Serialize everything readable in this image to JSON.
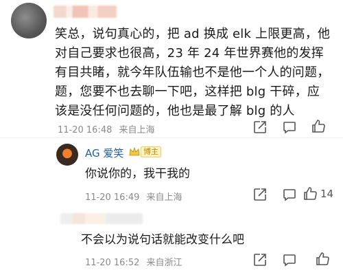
{
  "comment1": {
    "text_lines": [
      "笑总，说句真心的，把 ad 换成 elk 上限更高，他",
      "对自己要求也很高，23 年 24 年世界赛他的发挥",
      "有目共睹，就今年队伍输也不是他一个人的问题，",
      "题，您要不也去聊一下吧，这样把 blg 干碎，应",
      "该是没任何问题的，他也是最了解 blg 的人"
    ],
    "time": "11-20 16:48",
    "location": "来自上海"
  },
  "reply_ag": {
    "name": "AG 爱笑",
    "badge": "博主",
    "text": "你说你的，我干我的",
    "time": "11-20 16:49",
    "location": "来自上海",
    "like_count": "14"
  },
  "reply3": {
    "text": "不会以为说句话就能改变什么吧",
    "time": "11-20 16:52",
    "location": "来自浙江"
  },
  "icons": {
    "share": "share-icon",
    "comment": "comment-icon",
    "like": "thumbs-up-icon"
  },
  "colors": {
    "name_link": "#1f5fa8",
    "meta": "#8a8a8a",
    "badge": "#f0cf66"
  }
}
